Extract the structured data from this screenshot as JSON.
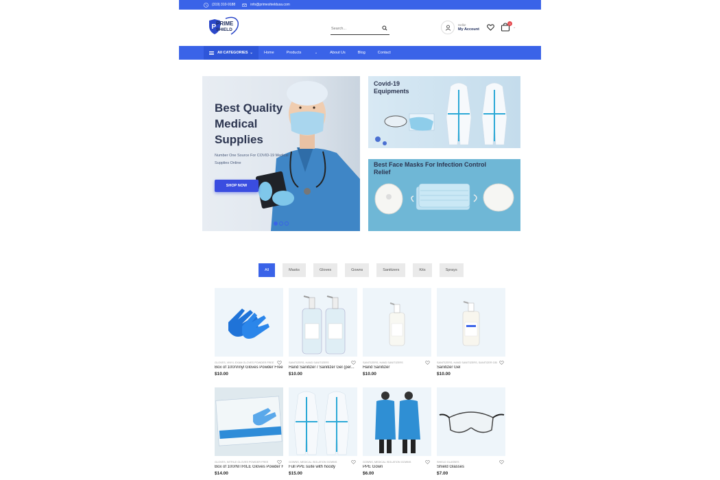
{
  "topbar": {
    "phone": "(319) 310-9188",
    "email": "info@primeshieldusa.com"
  },
  "header": {
    "logo_text": "PRIME SHIELD",
    "search_placeholder": "Search...",
    "account_hello": "Hello!",
    "account_label": "My Account",
    "cart_count": "0"
  },
  "nav": {
    "categories_label": "All CATEGORIES",
    "links": [
      "Home",
      "Products",
      "About Us",
      "Blog",
      "Contact"
    ]
  },
  "hero": {
    "title": "Best Quality Medical Supplies",
    "subtitle": "Number One Source For COVID-19 Medical Supplies Online",
    "button": "SHOP NOW"
  },
  "banners": [
    {
      "title": "Covid-19 Equipments"
    },
    {
      "title": "Best Face Masks For Infection Control Relief"
    }
  ],
  "filters": [
    "All",
    "Masks",
    "Gloves",
    "Gowns",
    "Sanitizers",
    "Kits",
    "Sprays"
  ],
  "products": [
    {
      "cats": "GLOVES, VINYL EXAM GLOVES POWDER FREE",
      "name": "Box of 100/Vinyl Gloves Powder Free",
      "price": "$10.00"
    },
    {
      "cats": "SANITIZERS, HAND SANITIZERS",
      "name": "Hand Sanitizer / Sanitizer Gel (per...",
      "price": "$10.00"
    },
    {
      "cats": "SANITIZERS, HAND SANITIZERS",
      "name": "Hand Sanitizer",
      "price": "$10.00"
    },
    {
      "cats": "SANITIZERS, HAND SANITIZERS, SANITIZER GEL",
      "name": "Sanitizer Gel",
      "price": "$10.00"
    },
    {
      "cats": "GLOVES, NITRILE GLOVES POWDER FREE",
      "name": "Box of 100/NITRILE Gloves Powder F...",
      "price": "$14.00"
    },
    {
      "cats": "GOWNS, MEDICAL ISOLATION GOWNS",
      "name": "Full PPE suite with hoody",
      "price": "$15.00"
    },
    {
      "cats": "GOWNS, MEDICAL ISOLATION GOWNS",
      "name": "PPE Gown",
      "price": "$6.00"
    },
    {
      "cats": "SHIELD GLASSES",
      "name": "Shield Glasses",
      "price": "$7.00"
    }
  ],
  "colors": {
    "primary": "#3a63e8",
    "dark_text": "#2c3550"
  }
}
